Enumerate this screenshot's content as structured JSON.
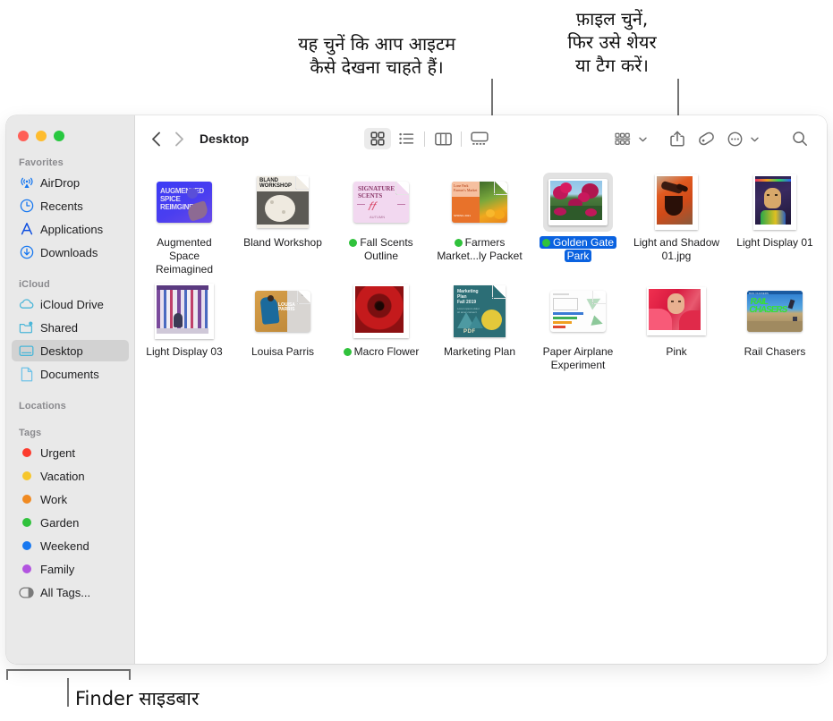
{
  "callouts": {
    "view_options": "यह चुनें कि आप आइटम\nकैसे देखना चाहते हैं।",
    "share_tag": "फ़ाइल चुनें,\nफिर उसे शेयर\nया टैग करें।",
    "sidebar": "Finder साइडबार"
  },
  "window": {
    "traffic_lights": {
      "close_label": "Close",
      "minimize_label": "Minimize",
      "maximize_label": "Maximize",
      "close_color": "#ff5f57",
      "minimize_color": "#febc2e",
      "maximize_color": "#28c840"
    }
  },
  "toolbar": {
    "back_label": "Back",
    "forward_label": "Forward",
    "path_title": "Desktop",
    "view_icon_label": "Icon View",
    "view_list_label": "List View",
    "view_column_label": "Column View",
    "view_gallery_label": "Gallery View",
    "group_label": "Group Items",
    "share_label": "Share",
    "tag_label": "Tags",
    "more_label": "More",
    "search_label": "Search",
    "active_view": "icon"
  },
  "sidebar": {
    "sections": [
      {
        "title": "Favorites",
        "items": [
          {
            "label": "AirDrop",
            "icon": "airdrop-icon",
            "selected": false
          },
          {
            "label": "Recents",
            "icon": "clock-icon",
            "selected": false
          },
          {
            "label": "Applications",
            "icon": "applications-icon",
            "selected": false
          },
          {
            "label": "Downloads",
            "icon": "downloads-icon",
            "selected": false
          }
        ]
      },
      {
        "title": "iCloud",
        "items": [
          {
            "label": "iCloud Drive",
            "icon": "cloud-icon",
            "selected": false
          },
          {
            "label": "Shared",
            "icon": "shared-folder-icon",
            "selected": false
          },
          {
            "label": "Desktop",
            "icon": "desktop-icon",
            "selected": true
          },
          {
            "label": "Documents",
            "icon": "document-icon",
            "selected": false
          }
        ]
      },
      {
        "title": "Locations",
        "items": []
      },
      {
        "title": "Tags",
        "items": [
          {
            "label": "Urgent",
            "icon": "tag-dot-icon",
            "color": "#fc3b2d",
            "selected": false
          },
          {
            "label": "Vacation",
            "icon": "tag-dot-icon",
            "color": "#f6c62c",
            "selected": false
          },
          {
            "label": "Work",
            "icon": "tag-dot-icon",
            "color": "#f08a21",
            "selected": false
          },
          {
            "label": "Garden",
            "icon": "tag-dot-icon",
            "color": "#30c23c",
            "selected": false
          },
          {
            "label": "Weekend",
            "icon": "tag-dot-icon",
            "color": "#1878f0",
            "selected": false
          },
          {
            "label": "Family",
            "icon": "tag-dot-icon",
            "color": "#b254e0",
            "selected": false
          },
          {
            "label": "All Tags...",
            "icon": "all-tags-icon",
            "color": "",
            "selected": false
          }
        ]
      }
    ]
  },
  "files": {
    "rows": [
      [
        {
          "name": "Augmented\nSpace Reimagined",
          "tag_color": "",
          "selected": false,
          "thumb": "augmented-space"
        },
        {
          "name": "Bland Workshop",
          "tag_color": "",
          "selected": false,
          "thumb": "bland-workshop"
        },
        {
          "name": "Fall Scents\nOutline",
          "tag_color": "#30c23c",
          "selected": false,
          "thumb": "fall-scents"
        },
        {
          "name": "Farmers\nMarket...ly Packet",
          "tag_color": "#30c23c",
          "selected": false,
          "thumb": "farmers-market"
        },
        {
          "name": "Golden Gate\nPark",
          "tag_color": "#30c23c",
          "selected": true,
          "thumb": "golden-gate"
        },
        {
          "name": "Light and Shadow\n01.jpg",
          "tag_color": "",
          "selected": false,
          "thumb": "light-shadow"
        },
        {
          "name": "Light Display 01",
          "tag_color": "",
          "selected": false,
          "thumb": "light-display-01"
        }
      ],
      [
        {
          "name": "Light Display 03",
          "tag_color": "",
          "selected": false,
          "thumb": "light-display-03"
        },
        {
          "name": "Louisa Parris",
          "tag_color": "",
          "selected": false,
          "thumb": "louisa-parris"
        },
        {
          "name": "Macro Flower",
          "tag_color": "#30c23c",
          "selected": false,
          "thumb": "macro-flower"
        },
        {
          "name": "Marketing Plan",
          "tag_color": "",
          "selected": false,
          "thumb": "marketing-plan"
        },
        {
          "name": "Paper Airplane\nExperiment",
          "tag_color": "",
          "selected": false,
          "thumb": "paper-airplane"
        },
        {
          "name": "Pink",
          "tag_color": "",
          "selected": false,
          "thumb": "pink"
        },
        {
          "name": "Rail Chasers",
          "tag_color": "",
          "selected": false,
          "thumb": "rail-chasers"
        }
      ]
    ]
  },
  "colors": {
    "selection_blue": "#0a62e0",
    "sidebar_bg": "#e9e9e9",
    "sidebar_selected": "#d2d2d2",
    "callout_line": "#737373"
  }
}
